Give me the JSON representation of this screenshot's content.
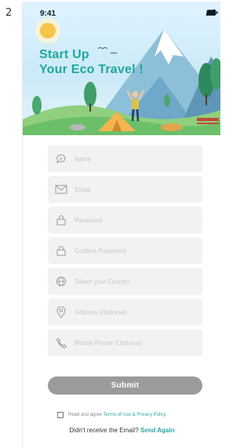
{
  "page_index": "2",
  "status_bar": {
    "time": "9:41"
  },
  "hero": {
    "title_line1": "Start Up",
    "title_line2": "Your Eco Travel !"
  },
  "form": {
    "name_placeholder": "Name",
    "email_placeholder": "Email",
    "password_placeholder": "Password",
    "confirm_password_placeholder": "Confirm Password",
    "country_placeholder": "Select your Country",
    "address_placeholder": "Address (Optional)",
    "phone_placeholder": "Mobile Phone (Optional)"
  },
  "submit_label": "Submit",
  "agree": {
    "prefix": "Read and agree",
    "terms": "Terms of Use",
    "amp": "&",
    "privacy": "Privacy Policy"
  },
  "resend": {
    "text": "Didn't receive the Email?",
    "link": "Send Again"
  },
  "colors": {
    "accent": "#2aa6a0",
    "field_bg": "#f2f2f2",
    "submit_bg": "#9b9b9b"
  }
}
